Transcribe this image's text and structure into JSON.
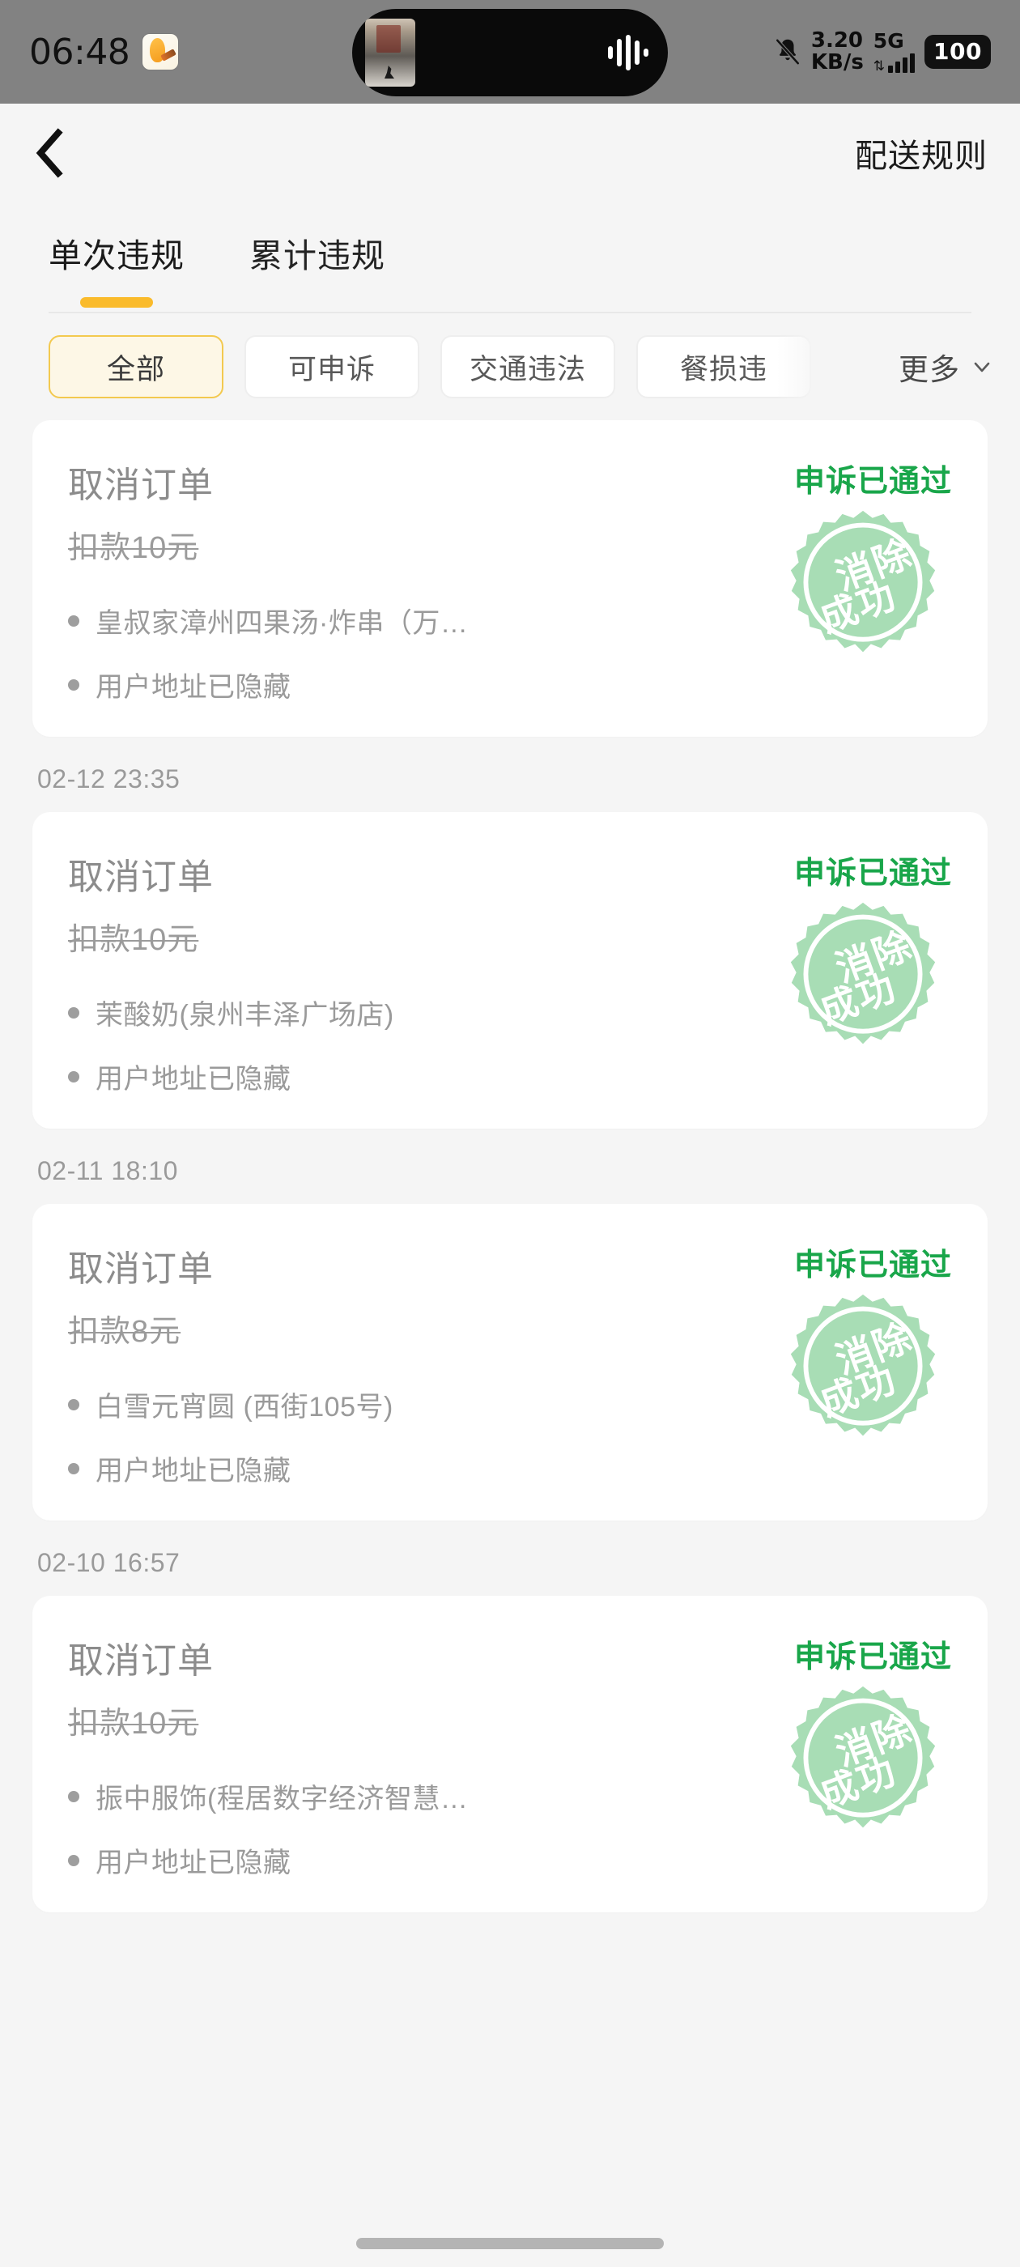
{
  "status_bar": {
    "time": "06:48",
    "app_icon": "squirrel-app-icon",
    "island_media_icon": "media-thumbnail",
    "wave_icon": "audio-wave-icon",
    "mute_icon": "bell-off-icon",
    "net_speed_value": "3.20",
    "net_speed_unit": "KB/s",
    "network_type": "5G",
    "signal_icon": "signal-bars-icon",
    "battery": "100"
  },
  "header": {
    "back_icon": "chevron-left-icon",
    "title": "配送规则"
  },
  "tabs": [
    {
      "label": "单次违规",
      "active": true
    },
    {
      "label": "累计违规",
      "active": false
    }
  ],
  "filters": {
    "chips": [
      {
        "label": "全部",
        "active": true
      },
      {
        "label": "可申诉",
        "active": false
      },
      {
        "label": "交通违法",
        "active": false
      },
      {
        "label": "餐损违",
        "active": false
      }
    ],
    "more_label": "更多",
    "more_icon": "chevron-down-icon"
  },
  "seal": {
    "line1": "消除",
    "line2": "成功",
    "color": "#a8ddb5"
  },
  "colors": {
    "accent_yellow": "#fabb2c",
    "status_green": "#19a64a",
    "page_bg": "#f5f5f5",
    "card_bg": "#ffffff",
    "muted_text": "#9a9a9a"
  },
  "records": [
    {
      "timestamp": "",
      "title": "取消订单",
      "amount": "扣款10元",
      "status": "申诉已通过",
      "bullets": [
        "皇叔家漳州四果汤·炸串（万…",
        "用户地址已隐藏"
      ]
    },
    {
      "timestamp": "02-12 23:35",
      "title": "取消订单",
      "amount": "扣款10元",
      "status": "申诉已通过",
      "bullets": [
        "茉酸奶(泉州丰泽广场店)",
        "用户地址已隐藏"
      ]
    },
    {
      "timestamp": "02-11 18:10",
      "title": "取消订单",
      "amount": "扣款8元",
      "status": "申诉已通过",
      "bullets": [
        "白雪元宵圆 (西街105号)",
        "用户地址已隐藏"
      ]
    },
    {
      "timestamp": "02-10 16:57",
      "title": "取消订单",
      "amount": "扣款10元",
      "status": "申诉已通过",
      "bullets": [
        "振中服饰(程居数字经济智慧…",
        "用户地址已隐藏"
      ]
    }
  ]
}
